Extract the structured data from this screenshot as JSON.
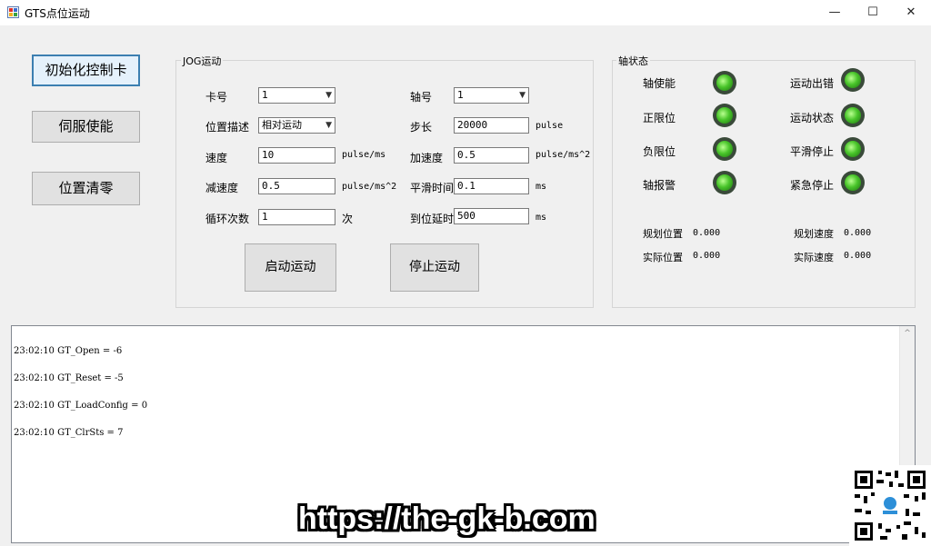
{
  "window": {
    "title": "GTS点位运动",
    "minimize_glyph": "—",
    "maximize_glyph": "☐",
    "close_glyph": "✕"
  },
  "left_buttons": {
    "init": "初始化控制卡",
    "servo": "伺服使能",
    "zero": "位置清零"
  },
  "jog": {
    "legend": "JOG运动",
    "card_label": "卡号",
    "card_value": "1",
    "axis_label": "轴号",
    "axis_value": "1",
    "pos_desc_label": "位置描述",
    "pos_desc_value": "相对运动",
    "step_label": "步长",
    "step_value": "20000",
    "step_unit": "pulse",
    "speed_label": "速度",
    "speed_value": "10",
    "speed_unit": "pulse/ms",
    "accel_label": "加速度",
    "accel_value": "0.5",
    "accel_unit": "pulse/ms^2",
    "decel_label": "减速度",
    "decel_value": "0.5",
    "decel_unit": "pulse/ms^2",
    "smooth_label": "平滑时间",
    "smooth_value": "0.1",
    "smooth_unit": "ms",
    "loop_label": "循环次数",
    "loop_value": "1",
    "loop_unit": "次",
    "delay_label": "到位延时",
    "delay_value": "500",
    "delay_unit": "ms",
    "start_button": "启动运动",
    "stop_button": "停止运动"
  },
  "axis_status": {
    "legend": "轴状态",
    "enable": "轴使能",
    "pos_limit": "正限位",
    "neg_limit": "负限位",
    "alarm": "轴报警",
    "motion_error": "运动出错",
    "motion_state": "运动状态",
    "smooth_stop": "平滑停止",
    "emergency_stop": "紧急停止",
    "plan_pos_label": "规划位置",
    "plan_pos_value": "0.000",
    "real_pos_label": "实际位置",
    "real_pos_value": "0.000",
    "plan_vel_label": "规划速度",
    "plan_vel_value": "0.000",
    "real_vel_label": "实际速度",
    "real_vel_value": "0.000",
    "led_color": "#49c52a"
  },
  "log": {
    "lines": [
      "23:02:10 GT_Open = -6",
      "23:02:10 GT_Reset = -5",
      "23:02:10 GT_LoadConfig = 0",
      "23:02:10 GT_ClrSts = 7"
    ],
    "scroll_up_glyph": "^"
  },
  "watermark": {
    "text": "https://the-gk-b.com"
  }
}
